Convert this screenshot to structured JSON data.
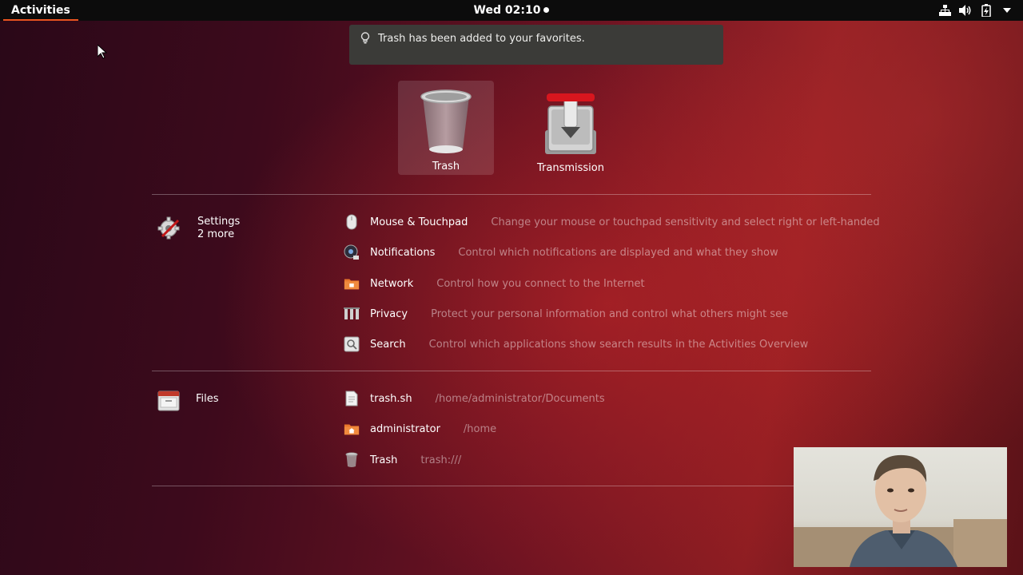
{
  "topbar": {
    "activities_label": "Activities",
    "clock": "Wed 02:10",
    "tray_icons": [
      "network-icon",
      "volume-icon",
      "battery-icon",
      "system-menu-arrow-icon"
    ]
  },
  "notification": {
    "icon": "lightbulb-icon",
    "text": "Trash has been added to your favorites."
  },
  "favorites": [
    {
      "label": "Trash",
      "icon": "trash-app-icon",
      "selected": true
    },
    {
      "label": "Transmission",
      "icon": "transmission-app-icon",
      "selected": false
    }
  ],
  "settings_section": {
    "provider_name": "Settings",
    "provider_more": "2 more",
    "results": [
      {
        "title": "Mouse & Touchpad",
        "description": "Change your mouse or touchpad sensitivity and select right or left-handed",
        "icon": "mouse-icon"
      },
      {
        "title": "Notifications",
        "description": "Control which notifications are displayed and what they show",
        "icon": "notifications-icon"
      },
      {
        "title": "Network",
        "description": "Control how you connect to the Internet",
        "icon": "network-folder-icon"
      },
      {
        "title": "Privacy",
        "description": "Protect your personal information and control what others might see",
        "icon": "privacy-icon"
      },
      {
        "title": "Search",
        "description": "Control which applications show search results in the Activities Overview",
        "icon": "search-settings-icon"
      }
    ]
  },
  "files_section": {
    "provider_name": "Files",
    "results": [
      {
        "title": "trash.sh",
        "description": "/home/administrator/Documents",
        "icon": "text-file-icon"
      },
      {
        "title": "administrator",
        "description": "/home",
        "icon": "home-folder-icon"
      },
      {
        "title": "Trash",
        "description": "trash:///",
        "icon": "trash-icon"
      }
    ]
  },
  "colors": {
    "accent": "#e95420",
    "topbar": "#0c0c0c",
    "notification_bg": "#3b3b38"
  }
}
